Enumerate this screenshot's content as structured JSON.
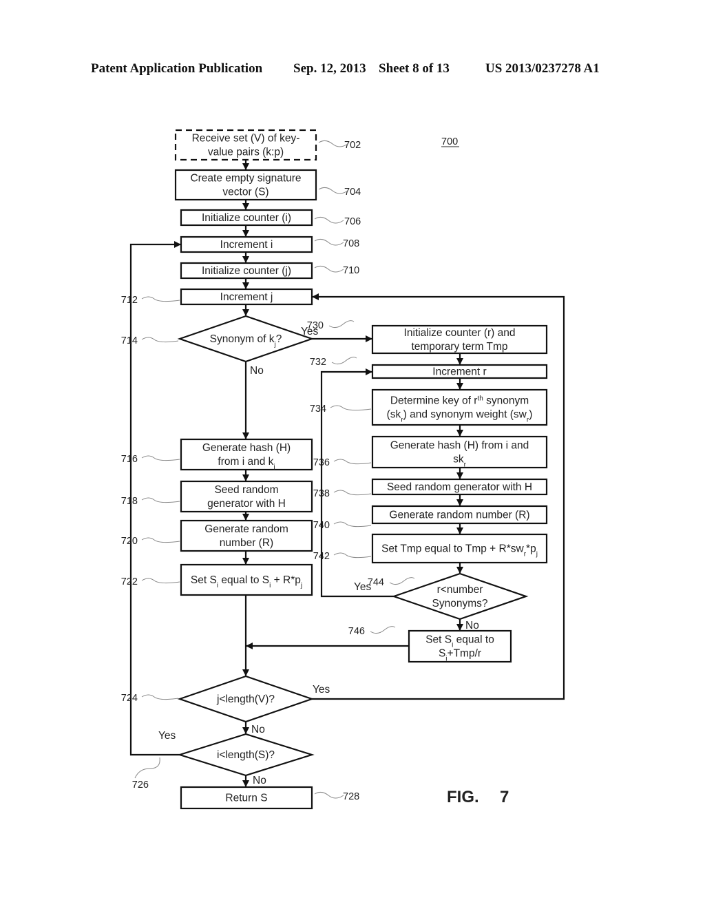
{
  "header": {
    "left": "Patent Application Publication",
    "date": "Sep. 12, 2013",
    "sheet": "Sheet 8 of 13",
    "number": "US 2013/0237278 A1"
  },
  "figure": {
    "number_label": "700",
    "caption": "FIG.",
    "caption_num": "7"
  },
  "nodes": [
    {
      "id": "702",
      "type": "process-dashed",
      "lines": [
        "Receive set (V) of key-",
        "value pairs (k:p)"
      ]
    },
    {
      "id": "704",
      "type": "process",
      "lines": [
        "Create empty signature",
        "vector (S)"
      ]
    },
    {
      "id": "706",
      "type": "process",
      "lines": [
        "Initialize counter (i)"
      ]
    },
    {
      "id": "708",
      "type": "process",
      "lines": [
        "Increment i"
      ]
    },
    {
      "id": "710",
      "type": "process",
      "lines": [
        "Initialize counter (j)"
      ]
    },
    {
      "id": "712",
      "type": "process",
      "lines": [
        "Increment j"
      ]
    },
    {
      "id": "714",
      "type": "decision",
      "lines": [
        "Synonym of k_j?"
      ]
    },
    {
      "id": "716",
      "type": "process",
      "lines": [
        "Generate hash (H)",
        "from i and k_j"
      ]
    },
    {
      "id": "718",
      "type": "process",
      "lines": [
        "Seed random",
        "generator with H"
      ]
    },
    {
      "id": "720",
      "type": "process",
      "lines": [
        "Generate random",
        "number (R)"
      ]
    },
    {
      "id": "722",
      "type": "process",
      "lines": [
        "Set S_i equal to S_i + R*p_j"
      ]
    },
    {
      "id": "724",
      "type": "decision",
      "lines": [
        "j<length(V)?"
      ]
    },
    {
      "id": "726",
      "type": "decision",
      "lines": [
        "i<length(S)?"
      ]
    },
    {
      "id": "728",
      "type": "process",
      "lines": [
        "Return S"
      ]
    },
    {
      "id": "730",
      "type": "process",
      "lines": [
        "Initialize counter (r) and",
        "temporary term Tmp"
      ]
    },
    {
      "id": "732",
      "type": "process",
      "lines": [
        "Increment r"
      ]
    },
    {
      "id": "734",
      "type": "process",
      "lines": [
        "Determine key of r^th synonym",
        "(sk_r) and synonym weight (sw_r)"
      ]
    },
    {
      "id": "736",
      "type": "process",
      "lines": [
        "Generate hash (H) from i and",
        "sk_r"
      ]
    },
    {
      "id": "738",
      "type": "process",
      "lines": [
        "Seed random generator with H"
      ]
    },
    {
      "id": "740",
      "type": "process",
      "lines": [
        "Generate random number (R)"
      ]
    },
    {
      "id": "742",
      "type": "process",
      "lines": [
        "Set Tmp equal to Tmp + R*sw_r*p_j"
      ]
    },
    {
      "id": "744",
      "type": "decision",
      "lines": [
        "r<number",
        "Synonyms?"
      ]
    },
    {
      "id": "746",
      "type": "process",
      "lines": [
        "Set S_i equal to",
        "S_i+Tmp/r"
      ]
    }
  ],
  "edge_labels": {
    "yes": "Yes",
    "no": "No"
  }
}
